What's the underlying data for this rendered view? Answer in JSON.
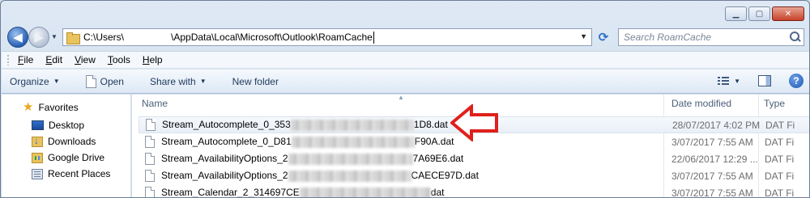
{
  "window": {
    "caption_buttons": {
      "minimize": "▁",
      "maximize": "▢",
      "close": "✕"
    }
  },
  "address_bar": {
    "path_prefix": "C:\\Users\\",
    "path_suffix": "\\AppData\\Local\\Microsoft\\Outlook\\RoamCache",
    "dropdown": "▼",
    "refresh": "⟳"
  },
  "search": {
    "placeholder": "Search RoamCache"
  },
  "menu": [
    {
      "label": "File",
      "mnemonic": "F",
      "rest": "ile"
    },
    {
      "label": "Edit",
      "mnemonic": "E",
      "rest": "dit"
    },
    {
      "label": "View",
      "mnemonic": "V",
      "rest": "iew"
    },
    {
      "label": "Tools",
      "mnemonic": "T",
      "rest": "ools"
    },
    {
      "label": "Help",
      "mnemonic": "H",
      "rest": "elp"
    }
  ],
  "commands": {
    "organize": "Organize",
    "open": "Open",
    "share_with": "Share with",
    "new_folder": "New folder",
    "help": "?"
  },
  "nav_pane": {
    "favorites": "Favorites",
    "items": [
      "Desktop",
      "Downloads",
      "Google Drive",
      "Recent Places"
    ]
  },
  "columns": {
    "name": "Name",
    "date_modified": "Date modified",
    "type": "Type"
  },
  "files": [
    {
      "prefix": "Stream_Autocomplete_0_353",
      "suffix": "1D8.dat",
      "date": "28/07/2017 4:02 PM",
      "type": "DAT Fi"
    },
    {
      "prefix": "Stream_Autocomplete_0_D81",
      "suffix": "F90A.dat",
      "date": "3/07/2017 7:55 AM",
      "type": "DAT Fi"
    },
    {
      "prefix": "Stream_AvailabilityOptions_2",
      "suffix": "7A69E6.dat",
      "date": "22/06/2017 12:29 ...",
      "type": "DAT Fi"
    },
    {
      "prefix": "Stream_AvailabilityOptions_2",
      "suffix": "CAECE97D.dat",
      "date": "3/07/2017 7:55 AM",
      "type": "DAT Fi"
    },
    {
      "prefix": "Stream_Calendar_2_314697CE",
      "suffix": "dat",
      "date": "3/07/2017 7:55 AM",
      "type": "DAT Fi"
    }
  ],
  "colors": {
    "annotation_arrow": "#e0201b",
    "row_highlight": "#e9eff7"
  }
}
